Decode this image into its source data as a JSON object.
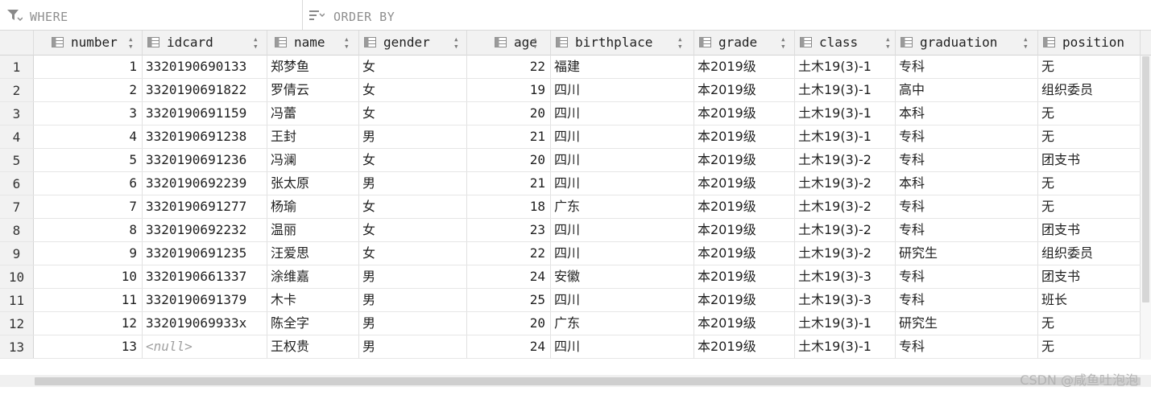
{
  "filters": {
    "where_label": "WHERE",
    "order_label": "ORDER BY"
  },
  "columns": [
    {
      "key": "number",
      "label": "number",
      "align": "right"
    },
    {
      "key": "idcard",
      "label": "idcard",
      "align": "left"
    },
    {
      "key": "name",
      "label": "name",
      "align": "left"
    },
    {
      "key": "gender",
      "label": "gender",
      "align": "left"
    },
    {
      "key": "age",
      "label": "age",
      "align": "right"
    },
    {
      "key": "birthplace",
      "label": "birthplace",
      "align": "left"
    },
    {
      "key": "grade",
      "label": "grade",
      "align": "left"
    },
    {
      "key": "class",
      "label": "class",
      "align": "left"
    },
    {
      "key": "graduation",
      "label": "graduation",
      "align": "left"
    },
    {
      "key": "position",
      "label": "position",
      "align": "left"
    }
  ],
  "null_text": "<null>",
  "rows": [
    {
      "row": "1",
      "number": "1",
      "idcard": "3320190690133",
      "name": "郑梦鱼",
      "gender": "女",
      "age": "22",
      "birthplace": "福建",
      "grade": "本2019级",
      "class": "土木19(3)-1",
      "graduation": "专科",
      "position": "无"
    },
    {
      "row": "2",
      "number": "2",
      "idcard": "3320190691822",
      "name": "罗倩云",
      "gender": "女",
      "age": "19",
      "birthplace": "四川",
      "grade": "本2019级",
      "class": "土木19(3)-1",
      "graduation": "高中",
      "position": "组织委员"
    },
    {
      "row": "3",
      "number": "3",
      "idcard": "3320190691159",
      "name": "冯蕾",
      "gender": "女",
      "age": "20",
      "birthplace": "四川",
      "grade": "本2019级",
      "class": "土木19(3)-1",
      "graduation": "本科",
      "position": "无"
    },
    {
      "row": "4",
      "number": "4",
      "idcard": "3320190691238",
      "name": "王封",
      "gender": "男",
      "age": "21",
      "birthplace": "四川",
      "grade": "本2019级",
      "class": "土木19(3)-1",
      "graduation": "专科",
      "position": "无"
    },
    {
      "row": "5",
      "number": "5",
      "idcard": "3320190691236",
      "name": "冯澜",
      "gender": "女",
      "age": "20",
      "birthplace": "四川",
      "grade": "本2019级",
      "class": "土木19(3)-2",
      "graduation": "专科",
      "position": "团支书"
    },
    {
      "row": "6",
      "number": "6",
      "idcard": "3320190692239",
      "name": "张太原",
      "gender": "男",
      "age": "21",
      "birthplace": "四川",
      "grade": "本2019级",
      "class": "土木19(3)-2",
      "graduation": "本科",
      "position": "无"
    },
    {
      "row": "7",
      "number": "7",
      "idcard": "3320190691277",
      "name": "杨瑜",
      "gender": "女",
      "age": "18",
      "birthplace": "广东",
      "grade": "本2019级",
      "class": "土木19(3)-2",
      "graduation": "专科",
      "position": "无"
    },
    {
      "row": "8",
      "number": "8",
      "idcard": "3320190692232",
      "name": "温丽",
      "gender": "女",
      "age": "23",
      "birthplace": "四川",
      "grade": "本2019级",
      "class": "土木19(3)-2",
      "graduation": "专科",
      "position": "团支书"
    },
    {
      "row": "9",
      "number": "9",
      "idcard": "3320190691235",
      "name": "汪爱思",
      "gender": "女",
      "age": "22",
      "birthplace": "四川",
      "grade": "本2019级",
      "class": "土木19(3)-2",
      "graduation": "研究生",
      "position": "组织委员"
    },
    {
      "row": "10",
      "number": "10",
      "idcard": "3320190661337",
      "name": "涂维嘉",
      "gender": "男",
      "age": "24",
      "birthplace": "安徽",
      "grade": "本2019级",
      "class": "土木19(3)-3",
      "graduation": "专科",
      "position": "团支书"
    },
    {
      "row": "11",
      "number": "11",
      "idcard": "3320190691379",
      "name": "木卡",
      "gender": "男",
      "age": "25",
      "birthplace": "四川",
      "grade": "本2019级",
      "class": "土木19(3)-3",
      "graduation": "专科",
      "position": "班长"
    },
    {
      "row": "12",
      "number": "12",
      "idcard": "332019069933x",
      "name": "陈全字",
      "gender": "男",
      "age": "20",
      "birthplace": "广东",
      "grade": "本2019级",
      "class": "土木19(3)-1",
      "graduation": "研究生",
      "position": "无"
    },
    {
      "row": "13",
      "number": "13",
      "idcard": null,
      "name": "王权贵",
      "gender": "男",
      "age": "24",
      "birthplace": "四川",
      "grade": "本2019级",
      "class": "土木19(3)-1",
      "graduation": "专科",
      "position": "无"
    }
  ],
  "watermark": "CSDN @咸鱼吐泡泡"
}
